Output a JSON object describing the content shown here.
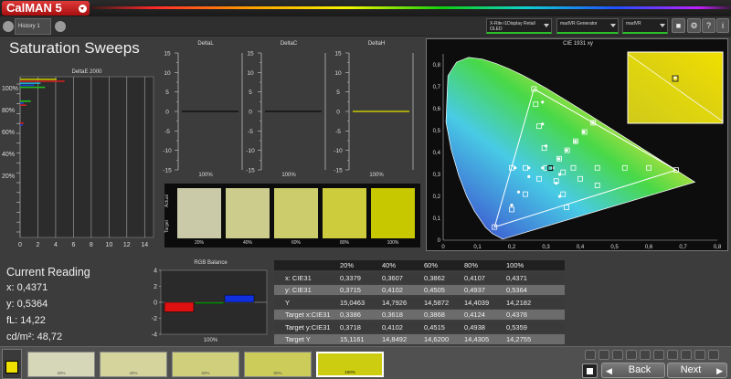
{
  "app": {
    "logo": "CalMAN 5"
  },
  "tabs": {
    "history": "History 1"
  },
  "devices": {
    "meter_line1": "X-Rite i1Display Retail",
    "meter_line2": "OLED",
    "generator": "madVR Generator",
    "display": "madVR"
  },
  "page": {
    "title": "Saturation Sweeps"
  },
  "deltae": {
    "title": "DeltaE 2000",
    "y_ticks": [
      "100%",
      "80%",
      "60%",
      "40%",
      "20%"
    ],
    "x_ticks": [
      "0",
      "2",
      "4",
      "6",
      "8",
      "10",
      "12",
      "14"
    ],
    "bars": [
      {
        "level": "100%",
        "value": 4.1,
        "color": "#c8c800"
      },
      {
        "level": "100%",
        "value": 5.0,
        "color": "#d02020"
      },
      {
        "level": "100%",
        "value": 2.3,
        "color": "#20b0d0"
      },
      {
        "level": "100%",
        "value": 1.6,
        "color": "#2040d0"
      },
      {
        "level": "100%",
        "value": 2.8,
        "color": "#20c020"
      },
      {
        "level": "80%",
        "value": 1.2,
        "color": "#20c020"
      },
      {
        "level": "80%",
        "value": 0.4,
        "color": "#2040d0"
      },
      {
        "level": "80%",
        "value": 0.7,
        "color": "#d02020"
      },
      {
        "level": "60%",
        "value": 0.4,
        "color": "#d02020"
      },
      {
        "level": "60%",
        "value": 0.3,
        "color": "#2040d0"
      }
    ]
  },
  "delta_charts": [
    {
      "title": "DeltaL",
      "y_ticks": [
        "15",
        "10",
        "5",
        "0",
        "-5",
        "-10",
        "-15"
      ],
      "x_label": "100%",
      "line_color": "#111111"
    },
    {
      "title": "DeltaC",
      "y_ticks": [
        "15",
        "10",
        "5",
        "0",
        "-5",
        "-10",
        "-15"
      ],
      "x_label": "100%",
      "line_color": "#111111"
    },
    {
      "title": "DeltaH",
      "y_ticks": [
        "15",
        "10",
        "5",
        "0",
        "-5",
        "-10",
        "-15"
      ],
      "x_label": "100%",
      "line_color": "#c8c800"
    }
  ],
  "swatch_panel": {
    "actual_label": "Actual",
    "target_label": "Target",
    "swatches": [
      {
        "label": "20%",
        "color": "#cacaa8"
      },
      {
        "label": "40%",
        "color": "#cccc8c"
      },
      {
        "label": "60%",
        "color": "#cccc6c"
      },
      {
        "label": "80%",
        "color": "#cccc3c"
      },
      {
        "label": "100%",
        "color": "#c8c800"
      }
    ]
  },
  "cie": {
    "title": "CIE 1931 xy",
    "x_ticks": [
      "0",
      "0,1",
      "0,2",
      "0,3",
      "0,4",
      "0,5",
      "0,6",
      "0,7",
      "0,8"
    ],
    "y_ticks": [
      "0,8",
      "0,7",
      "0,6",
      "0,5",
      "0,4",
      "0,3",
      "0,2",
      "0,1",
      "0"
    ],
    "gamut_triangle": [
      [
        0.68,
        0.32
      ],
      [
        0.265,
        0.69
      ],
      [
        0.15,
        0.06
      ]
    ],
    "white_point": [
      0.3127,
      0.329
    ],
    "targets": [
      [
        0.3386,
        0.3718
      ],
      [
        0.3618,
        0.4102
      ],
      [
        0.3868,
        0.4515
      ],
      [
        0.4124,
        0.4938
      ],
      [
        0.4378,
        0.5359
      ],
      [
        0.2,
        0.33
      ],
      [
        0.24,
        0.33
      ],
      [
        0.3,
        0.33
      ],
      [
        0.38,
        0.33
      ],
      [
        0.45,
        0.33
      ],
      [
        0.53,
        0.33
      ],
      [
        0.6,
        0.33
      ],
      [
        0.68,
        0.32
      ],
      [
        0.295,
        0.42
      ],
      [
        0.28,
        0.52
      ],
      [
        0.27,
        0.62
      ],
      [
        0.265,
        0.69
      ],
      [
        0.28,
        0.28
      ],
      [
        0.24,
        0.21
      ],
      [
        0.2,
        0.14
      ],
      [
        0.15,
        0.06
      ],
      [
        0.35,
        0.31
      ],
      [
        0.4,
        0.28
      ],
      [
        0.45,
        0.25
      ],
      [
        0.33,
        0.27
      ],
      [
        0.35,
        0.21
      ],
      [
        0.36,
        0.15
      ]
    ],
    "actuals": [
      [
        0.3379,
        0.3715
      ],
      [
        0.3607,
        0.4102
      ],
      [
        0.3862,
        0.4505
      ],
      [
        0.4107,
        0.4937
      ],
      [
        0.4371,
        0.5364
      ],
      [
        0.21,
        0.33
      ],
      [
        0.25,
        0.33
      ],
      [
        0.29,
        0.33
      ],
      [
        0.32,
        0.33
      ],
      [
        0.3,
        0.43
      ],
      [
        0.29,
        0.53
      ],
      [
        0.29,
        0.63
      ],
      [
        0.34,
        0.3
      ],
      [
        0.33,
        0.26
      ],
      [
        0.34,
        0.2
      ],
      [
        0.25,
        0.29
      ],
      [
        0.22,
        0.22
      ],
      [
        0.2,
        0.16
      ]
    ]
  },
  "current_reading": {
    "title": "Current Reading",
    "x": "x: 0,4371",
    "y": "y: 0,5364",
    "fl": "fL: 14,22",
    "cdm2": "cd/m²: 48,72"
  },
  "rgb_balance": {
    "title": "RGB Balance",
    "y_ticks": [
      "4",
      "2",
      "0",
      "-2",
      "-4"
    ],
    "x_label": "100%",
    "bars": [
      {
        "name": "R",
        "value": -1.2,
        "color": "#e01010"
      },
      {
        "name": "G",
        "value": -0.2,
        "color": "#10b010"
      },
      {
        "name": "B",
        "value": 0.9,
        "color": "#1030e0"
      }
    ]
  },
  "table": {
    "headers": [
      "",
      "20%",
      "40%",
      "60%",
      "80%",
      "100%"
    ],
    "rows": [
      [
        "x: CIE31",
        "0,3379",
        "0,3607",
        "0,3862",
        "0,4107",
        "0,4371"
      ],
      [
        "y: CIE31",
        "0,3715",
        "0,4102",
        "0,4505",
        "0,4937",
        "0,5364"
      ],
      [
        "Y",
        "15,0463",
        "14,7926",
        "14,5872",
        "14,4039",
        "14,2182"
      ],
      [
        "Target x:CIE31",
        "0,3386",
        "0,3618",
        "0,3868",
        "0,4124",
        "0,4378"
      ],
      [
        "Target y:CIE31",
        "0,3718",
        "0,4102",
        "0,4515",
        "0,4938",
        "0,5359"
      ],
      [
        "Target Y",
        "15,1161",
        "14,8492",
        "14,6200",
        "14,4305",
        "14,2755"
      ]
    ]
  },
  "bottom": {
    "swatches": [
      {
        "label": "20%",
        "color": "#d6d6b8"
      },
      {
        "label": "40%",
        "color": "#d4d49c"
      },
      {
        "label": "60%",
        "color": "#d0d07c"
      },
      {
        "label": "80%",
        "color": "#cccc5a"
      },
      {
        "label": "100%",
        "color": "#cccc10"
      }
    ],
    "current_swatch_color": "#f0e000",
    "back_label": "Back",
    "next_label": "Next"
  }
}
